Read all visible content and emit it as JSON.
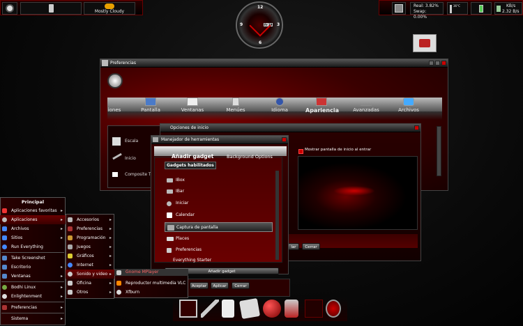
{
  "weather": {
    "label": "Mostly Cloudy"
  },
  "system": {
    "ram": "Real: 3.82%",
    "swap": "Swap: 0.00%",
    "temp": "36°C",
    "net_down": "KB/s",
    "net_up": "2.32 B/s"
  },
  "clock": {
    "n12": "12",
    "n3": "3",
    "n6": "6",
    "n9": "9",
    "date": "Fr 19"
  },
  "preferencias": {
    "title": "Preferencias",
    "categories": [
      "iones",
      "Pantalla",
      "Ventanas",
      "Menúes",
      "Idioma",
      "Apariencia",
      "Avanzadas",
      "Archivos"
    ],
    "rows": [
      "Escala",
      "Inicio",
      "Composite To..."
    ]
  },
  "opciones": {
    "title": "Opciones de inicio",
    "checkbox_label": "Mostrar pantalla de inicio al entrar",
    "buttons": [
      "Aceptar",
      "Aplicar",
      "Cerrar"
    ],
    "partial_button": "lar",
    "cerrar": "Cerrar"
  },
  "manager": {
    "title": "Manejador de herramientas",
    "tabs": [
      "Añadir gadget",
      "Background Options"
    ],
    "section": "Gadgets habilitados",
    "items": [
      "IBox",
      "IBar",
      "Iniciar",
      "Calendar",
      "Captura de pantalla",
      "Places",
      "Preferencias",
      "Everything Starter"
    ],
    "add_button": "Añadir gadget"
  },
  "menu_main": {
    "title": "Principal",
    "items": [
      "Aplicaciones favoritas",
      "Aplicaciones",
      "Archivos",
      "Sitios",
      "Run Everything",
      "Take Screenshot",
      "Escritorio",
      "Ventanas",
      "Bodhi Linux",
      "Enlightenment",
      "Preferencias",
      "Sistema"
    ]
  },
  "menu_apps": {
    "items": [
      "Accesorios",
      "Preferencias",
      "Programación",
      "Juegos",
      "Gráficos",
      "Internet",
      "Sonido y video",
      "Oficina",
      "Otros"
    ]
  },
  "menu_sound": {
    "items": [
      "Reproductor multimedia VLC",
      "Xfburn"
    ],
    "partial": "Gnome MPlayer"
  },
  "colors": {
    "accent": "#8b0000",
    "bright_red": "#cc0000"
  }
}
